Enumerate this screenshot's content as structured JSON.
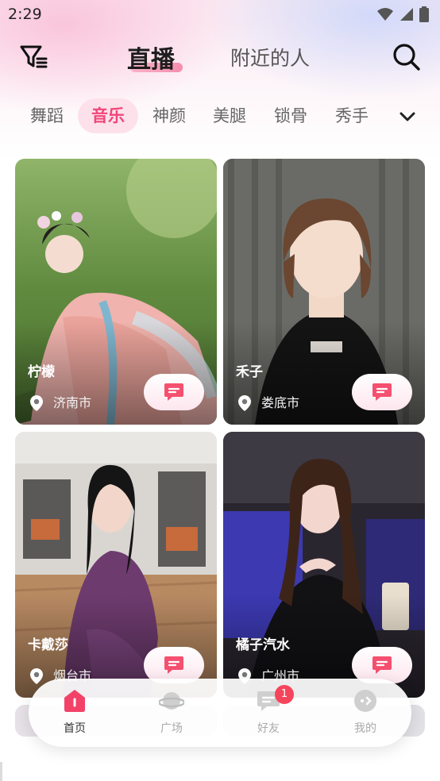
{
  "status_bar": {
    "time": "2:29"
  },
  "header": {
    "tab_live": "直播",
    "tab_nearby": "附近的人"
  },
  "categories": {
    "items": [
      "舞蹈",
      "音乐",
      "神颜",
      "美腿",
      "锁骨",
      "秀手"
    ],
    "active": "音乐"
  },
  "cards": [
    {
      "name": "柠檬",
      "location": "济南市"
    },
    {
      "name": "禾子",
      "location": "娄底市"
    },
    {
      "name": "卡戴莎",
      "location": "烟台市"
    },
    {
      "name": "橘子汽水",
      "location": "广州市"
    }
  ],
  "bottom_nav": {
    "items": [
      {
        "label": "首页",
        "icon": "home-icon",
        "active": true
      },
      {
        "label": "广场",
        "icon": "planet-icon",
        "active": false
      },
      {
        "label": "好友",
        "icon": "chat-icon",
        "active": false,
        "badge": "1"
      },
      {
        "label": "我的",
        "icon": "profile-icon",
        "active": false
      }
    ]
  },
  "colors": {
    "accent": "#f2457a",
    "accent_light": "#fde1ea",
    "badge": "#f5455c"
  }
}
